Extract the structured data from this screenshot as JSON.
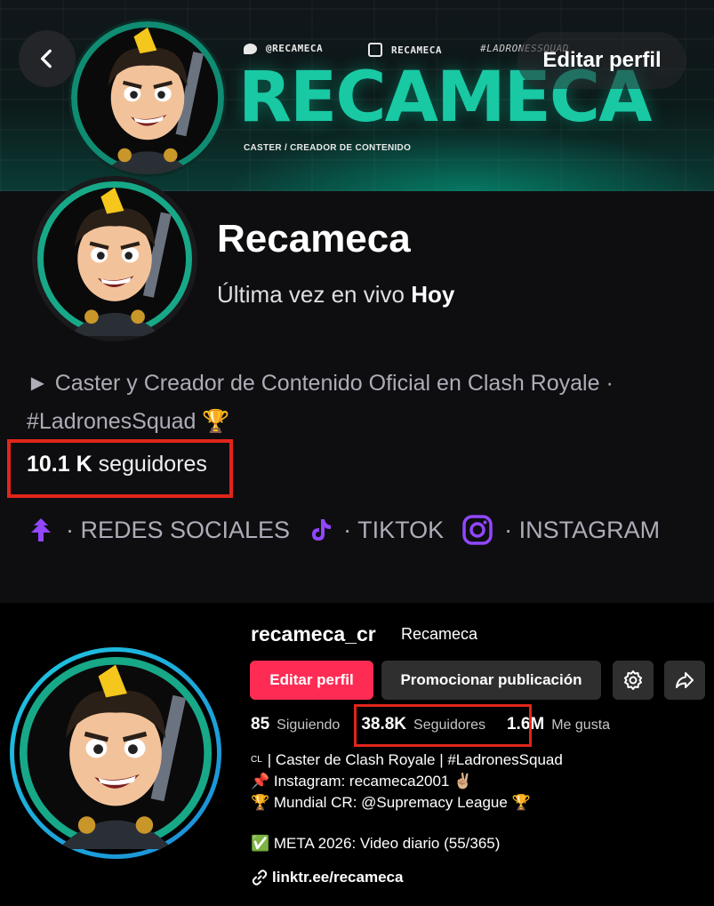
{
  "twitch": {
    "banner": {
      "social_twitter": "@RECAMECA",
      "social_twitch": "RECAMECA",
      "social_tag": "#LADRONESSQUAD",
      "title": "RECAMECA",
      "subtitle": "CASTER / CREADOR DE CONTENIDO"
    },
    "edit_profile_label": "Editar perfil",
    "channel_name": "Recameca",
    "last_live_prefix": "Última vez en vivo",
    "last_live_value": "Hoy",
    "bio_line1": "► Caster y Creador de Contenido Oficial en Clash Royale ·",
    "bio_line2": "#LadronesSquad 🏆",
    "followers_count": "10.1 K",
    "followers_label": "seguidores",
    "links": [
      {
        "label": "· REDES SOCIALES",
        "icon": "linktree-icon"
      },
      {
        "label": "· TIKTOK",
        "icon": "tiktok-icon"
      },
      {
        "label": "· INSTAGRAM",
        "icon": "instagram-icon"
      }
    ],
    "accent_color": "#9147ff",
    "highlight_color": "#e1251b"
  },
  "tiktok": {
    "username": "recameca_cr",
    "nickname": "Recameca",
    "edit_profile_label": "Editar perfil",
    "promote_label": "Promocionar publicación",
    "following_count": "85",
    "following_label": "Siguiendo",
    "followers_count": "38.8K",
    "followers_label": "Seguidores",
    "likes_count": "1.6M",
    "likes_label": "Me gusta",
    "bio": {
      "line1_badge": "CL",
      "line1": "| Caster de Clash Royale | #LadronesSquad",
      "line2": "📌 Instagram: recameca2001 ✌🏼",
      "line3": "🏆 Mundial CR: @Supremacy League 🏆",
      "line4": "✅ META 2026: Video diario (55/365)"
    },
    "link": "linktr.ee/recameca",
    "accent_color": "#fe2c55"
  }
}
